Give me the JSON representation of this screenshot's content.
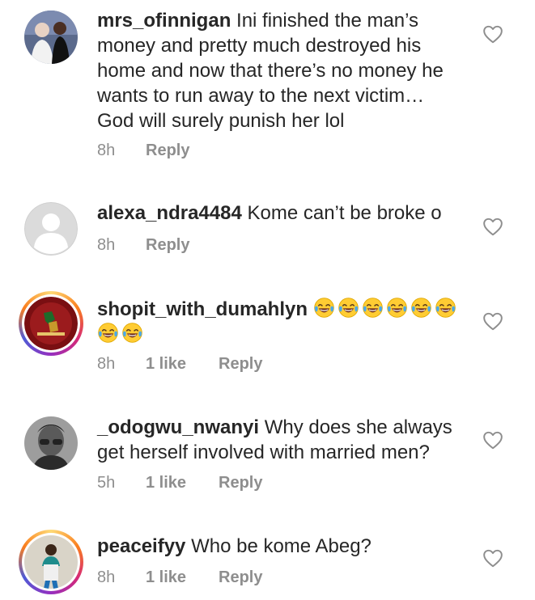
{
  "comments": [
    {
      "username": "mrs_ofinnigan",
      "text_lines": [
        "Ini finished the man’s",
        "money and pretty much destroyed his",
        "home and now that there’s no money he",
        "wants to run away to the next victim…",
        "God will surely punish her lol"
      ],
      "time": "8h",
      "likes": "",
      "reply": "Reply"
    },
    {
      "username": "alexa_ndra4484",
      "text_lines": [
        "Kome can’t be broke o"
      ],
      "time": "8h",
      "likes": "",
      "reply": "Reply"
    },
    {
      "username": "shopit_with_dumahlyn",
      "emoji": "face-with-tears-of-joy",
      "emoji_count": 8,
      "time": "8h",
      "likes": "1 like",
      "reply": "Reply"
    },
    {
      "username": "_odogwu_nwanyi",
      "text_lines": [
        "Why does she always",
        "get herself involved with married men?"
      ],
      "time": "5h",
      "likes": "1 like",
      "reply": "Reply"
    },
    {
      "username": "peaceifyy",
      "text_lines": [
        "Who be kome Abeg?"
      ],
      "time": "8h",
      "likes": "1 like",
      "reply": "Reply"
    }
  ],
  "colors": {
    "text": "#262626",
    "muted": "#8e8e8e",
    "heart_outline": "#8e8e8e"
  },
  "icons": {
    "like": "heart-outline-icon",
    "emoji": "face-with-tears-of-joy-emoji"
  }
}
